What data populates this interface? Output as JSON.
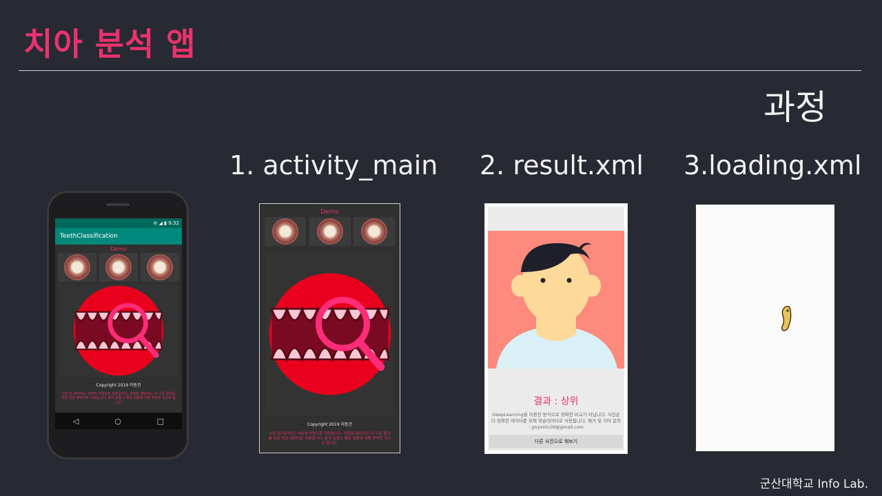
{
  "slide": {
    "title": "치아 분석 앱",
    "section_label": "과정",
    "footer": "군산대학교 Info Lab."
  },
  "steps": [
    {
      "label": "1. activity_main"
    },
    {
      "label": "2. result.xml"
    },
    {
      "label": "3.loading.xml"
    }
  ],
  "phone": {
    "status_time": "9:32",
    "app_title": "TeethClassification",
    "demo_label": "Demo",
    "copyright": "Copyright 2019 이동건",
    "notice": "사진 및 데이터는 서버에 익명으로 저장됩니다. 저장된 데이터는 더 나은 결과를 위한 학습 데이터로 사용됩니다. 분석 요청시 해당 내용에 대해 허락한 것으로 봅니다."
  },
  "activity_main": {
    "demo_label": "Demo",
    "copyright": "Copyright 2019 이동건",
    "notice": "사진 및 데이터는 서버에 익명으로 저장됩니다. 저장된 데이터는 더 나은 결과를 위한 학습 데이터로 사용됩니다. 분석 요청시 해당 내용에 대해 허락한 것으로 봅니다."
  },
  "result": {
    "result_text": "결과 : 상위",
    "desc": "DeepLeanring을 이용한 방식으로 정확한 비교가 아닙니다. 사진은 더 정확한 데이터를 위해 학습데이터로 사용됩니다. 제거 및 기타 문의 : gnyontu39@gmail.com",
    "retry_button": "다른 사진으로 해보기"
  },
  "loading": {
    "text": "loading"
  },
  "colors": {
    "background": "#272a33",
    "accent": "#e8336c",
    "teal": "#00897b",
    "salmon": "#fd8a7c"
  }
}
